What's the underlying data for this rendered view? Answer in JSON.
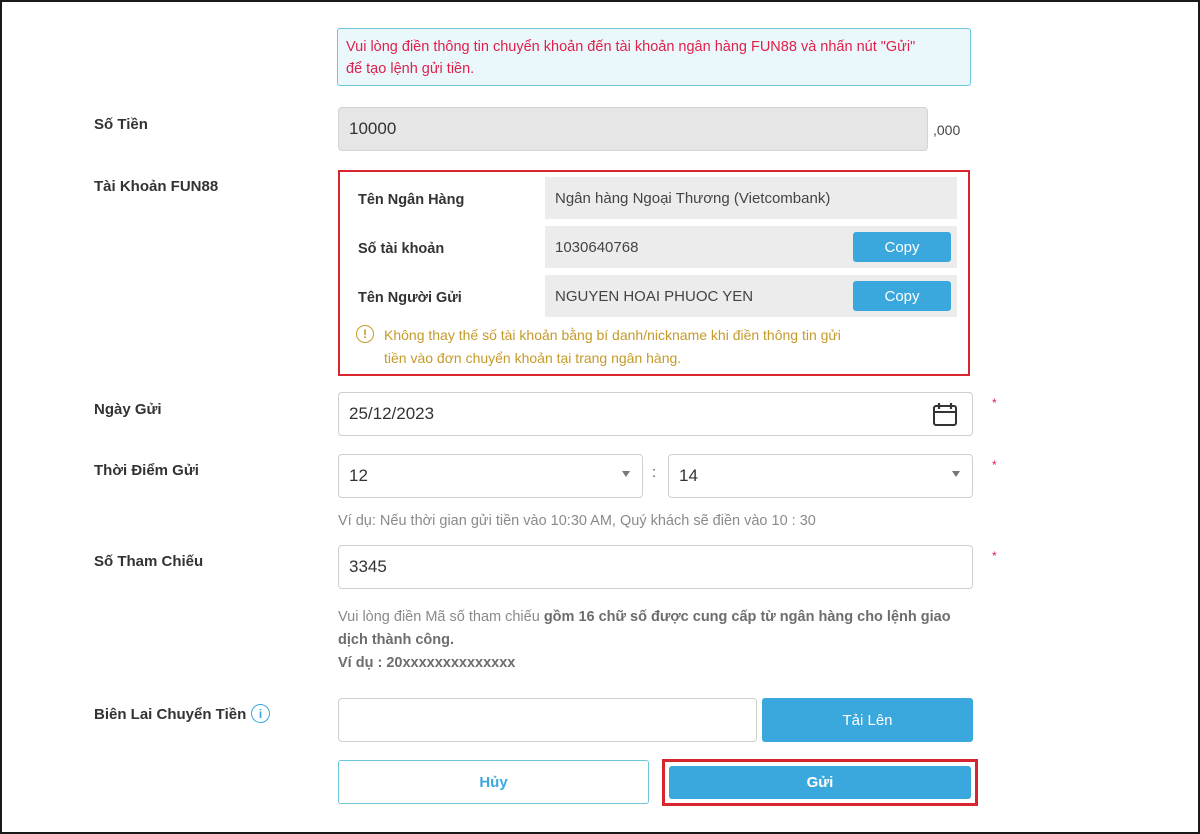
{
  "notice": {
    "line1": "Vui lòng điền thông tin chuyển khoản đến tài khoản ngân hàng FUN88 và nhấn nút \"Gửi\"",
    "line2": "để tạo lệnh gửi tiền."
  },
  "amount": {
    "label": "Số Tiền",
    "value": "10000",
    "suffix": ",000"
  },
  "account": {
    "label": "Tài Khoản FUN88",
    "rows": [
      {
        "label": "Tên Ngân Hàng",
        "value": "Ngân hàng Ngoại Thương (Vietcombank)"
      },
      {
        "label": "Số tài khoản",
        "value": "1030640768",
        "button": "Copy"
      },
      {
        "label": "Tên Người Gửi",
        "value": "NGUYEN HOAI PHUOC YEN",
        "button": "Copy"
      }
    ],
    "warning_icon": "!",
    "warning_line1": "Không thay thế số tài khoản bằng bí danh/nickname khi điền thông tin gửi",
    "warning_line2": "tiền vào đơn chuyển khoản tại trang ngân hàng."
  },
  "date": {
    "label": "Ngày Gửi",
    "value": "25/12/2023",
    "icon": "calendar-icon"
  },
  "time": {
    "label": "Thời Điểm Gửi",
    "hour": "12",
    "separator": ":",
    "minute": "14",
    "hint": "Ví dụ: Nếu thời gian gửi tiền vào 10:30 AM, Quý khách sẽ điền vào 10 : 30"
  },
  "reference": {
    "label": "Số Tham Chiếu",
    "value": "3345",
    "hint_prefix": "Vui lòng điền Mã số tham chiếu ",
    "hint_bold": "gồm 16 chữ số được cung cấp từ ngân hàng cho lệnh giao",
    "hint_bold2": "dịch thành công.",
    "example": "Ví dụ : 20xxxxxxxxxxxxxx"
  },
  "receipt": {
    "label": "Biên Lai Chuyển Tiền",
    "upload_button": "Tải Lên",
    "info_icon": "i"
  },
  "actions": {
    "cancel": "Hủy",
    "submit": "Gửi"
  },
  "required_mark": "*",
  "colors": {
    "accent": "#3aa8dc",
    "highlight": "#d9262e",
    "notice_text": "#e0204a",
    "warning": "#c59a2a"
  }
}
